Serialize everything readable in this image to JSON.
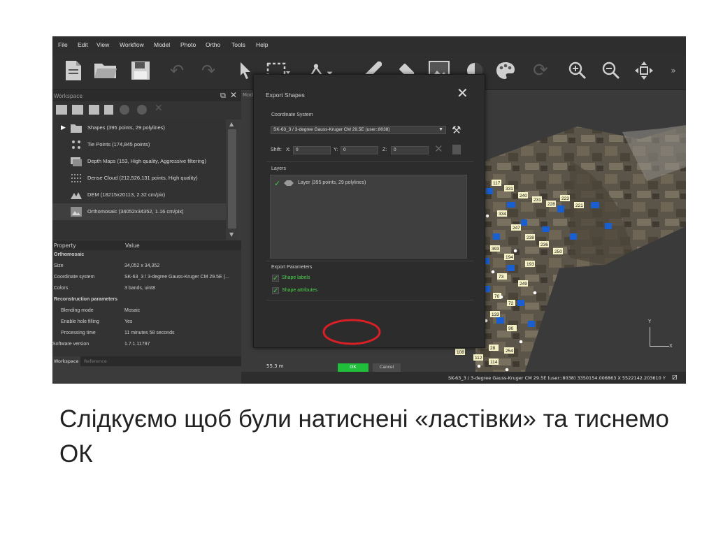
{
  "menu": [
    "File",
    "Edit",
    "View",
    "Workflow",
    "Model",
    "Photo",
    "Ortho",
    "Tools",
    "Help"
  ],
  "workspace": {
    "title": "Workspace",
    "items": [
      {
        "label": "Shapes (395 points, 29 polylines)",
        "icon": "folder-icon"
      },
      {
        "label": "Tie Points (174,845 points)",
        "icon": "tie-points-icon"
      },
      {
        "label": "Depth Maps (153, High quality, Aggressive filtering)",
        "icon": "depth-maps-icon"
      },
      {
        "label": "Dense Cloud (212,526,131 points, High quality)",
        "icon": "dense-cloud-icon"
      },
      {
        "label": "DEM (18215x20113, 2.32 cm/pix)",
        "icon": "dem-icon"
      },
      {
        "label": "Orthomosaic (34052x34352, 1.16 cm/pix)",
        "icon": "orthomosaic-icon"
      }
    ]
  },
  "properties": {
    "col_property": "Property",
    "col_value": "Value",
    "rows": [
      {
        "k": "Orthomosaic",
        "v": "",
        "header": true
      },
      {
        "k": "Size",
        "v": "34,052 x 34,352"
      },
      {
        "k": "Coordinate system",
        "v": "SK-63_3 / 3-degree Gauss-Kruger CM 29.5E (..."
      },
      {
        "k": "Colors",
        "v": "3 bands, uint8"
      },
      {
        "k": "Reconstruction parameters",
        "v": "",
        "header": true
      },
      {
        "k": "Blending mode",
        "v": "Mosaic",
        "indent": true
      },
      {
        "k": "Enable hole filling",
        "v": "Yes",
        "indent": true
      },
      {
        "k": "Processing time",
        "v": "11 minutes 58 seconds",
        "indent": true
      },
      {
        "k": "Software version",
        "v": "1.7.1.11797"
      }
    ]
  },
  "tabs": {
    "workspace": "Workspace",
    "reference": "Reference"
  },
  "map": {
    "tab_fragment": "Mod",
    "scale": "55.3 m",
    "axis_y": "Y",
    "axis_x": "X"
  },
  "status": "SK-63_3 / 3-degree Gauss-Kruger CM 29.5E (user::8038)  3350154.006863 X  5522142.203610 Y",
  "dialog": {
    "title": "Export Shapes",
    "coord_label": "Coordinate System",
    "coord_value": "SK-63_3 / 3-degree Gauss-Kruger CM 29.5E (user::8038)",
    "shift_label": "Shift:",
    "x_label": "X:",
    "x_value": "0",
    "y_label": "Y:",
    "y_value": "0",
    "z_label": "Z:",
    "z_value": "0",
    "layers_label": "Layers",
    "layer_item": "Layer (395 points, 29 polylines)",
    "export_params_label": "Export Parameters",
    "shape_labels": "Shape labels",
    "shape_attributes": "Shape attributes",
    "ok": "OK",
    "cancel": "Cancel"
  },
  "caption": "Слідкуємо щоб були натиснені «ластівки» та тиснемо ОК",
  "colors": {
    "accent_green": "#1fbf3c",
    "highlight_red": "#d81f26",
    "check_green": "#45c845",
    "marker_blue": "#1a5fd1",
    "label_yellow": "#f6f2c6"
  }
}
